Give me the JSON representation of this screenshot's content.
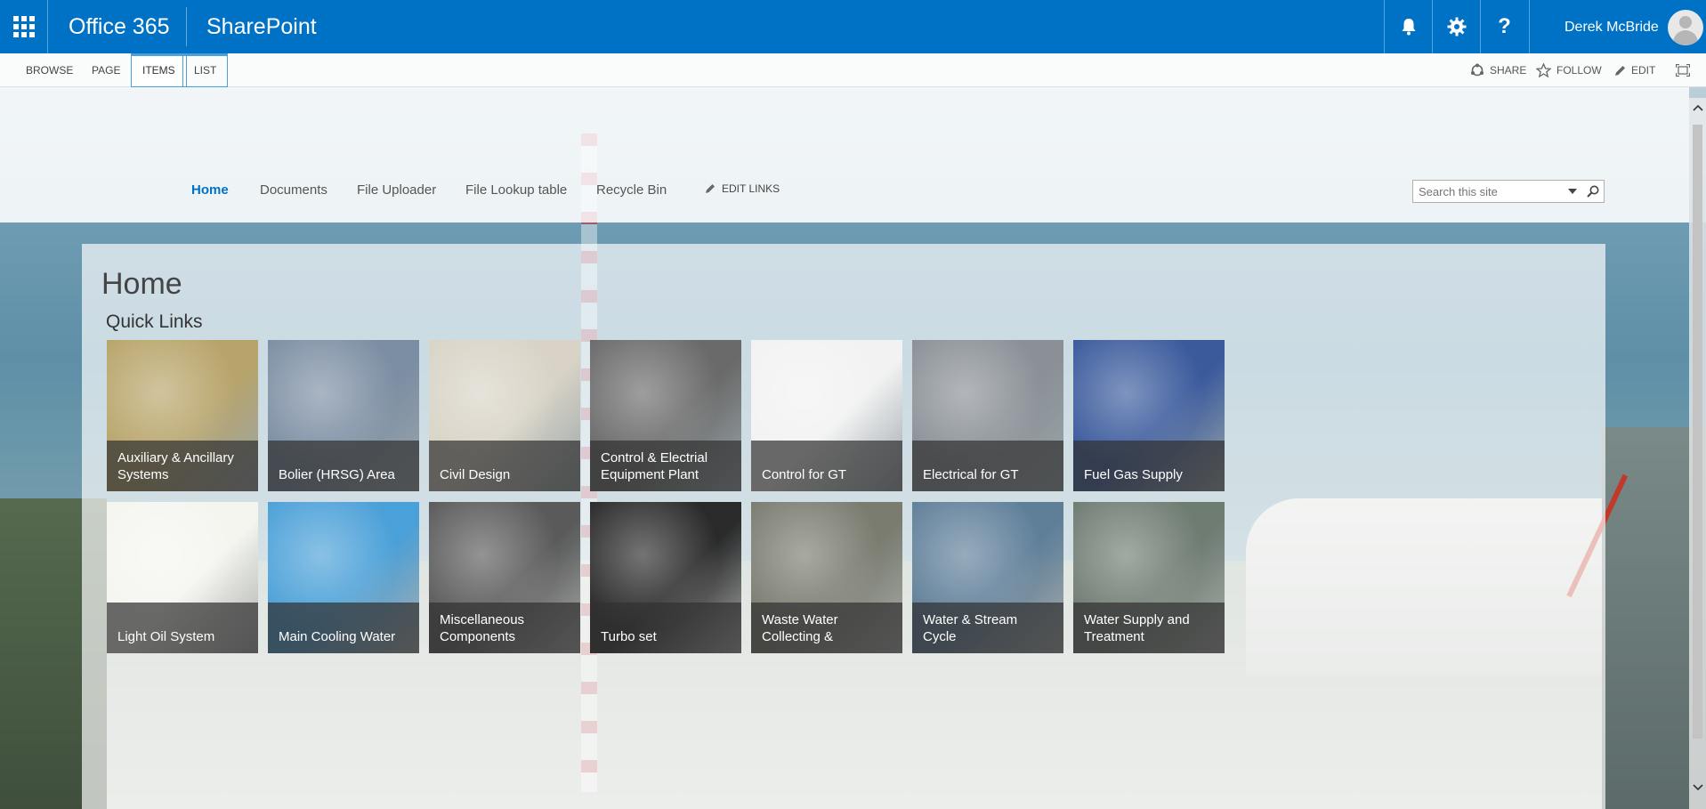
{
  "suite": {
    "brand_office": "Office 365",
    "brand_app": "SharePoint",
    "user_name": "Derek McBride",
    "icons": [
      "app-launcher-icon",
      "bell-icon",
      "gear-icon",
      "help-icon"
    ]
  },
  "ribbon": {
    "tabs": [
      "BROWSE",
      "PAGE",
      "ITEMS",
      "LIST"
    ],
    "active_tab": "ITEMS",
    "actions": {
      "share": "SHARE",
      "follow": "FOLLOW",
      "edit": "EDIT"
    }
  },
  "topnav": {
    "items": [
      "Home",
      "Documents",
      "File Uploader",
      "File Lookup table",
      "Recycle Bin"
    ],
    "selected": "Home",
    "edit_links": "EDIT LINKS"
  },
  "search": {
    "placeholder": "Search this site"
  },
  "page": {
    "title": "Home",
    "section_title": "Quick Links"
  },
  "tiles": [
    {
      "label": "Auxiliary & Ancillary Systems",
      "theme": "#b8a46a"
    },
    {
      "label": "Bolier (HRSG) Area",
      "theme": "#7c8ea3"
    },
    {
      "label": "Civil Design",
      "theme": "#d8d3c6"
    },
    {
      "label": "Control & Electrial Equipment Plant",
      "theme": "#6a6a6a"
    },
    {
      "label": "Control for GT",
      "theme": "#f2f2f2"
    },
    {
      "label": "Electrical for GT",
      "theme": "#8a9096"
    },
    {
      "label": "Fuel Gas Supply",
      "theme": "#3a5a9c"
    },
    {
      "label": "Light Oil System",
      "theme": "#f5f5f0"
    },
    {
      "label": "Main Cooling Water",
      "theme": "#4aa0d8"
    },
    {
      "label": "Miscellaneous Components",
      "theme": "#5a5a5a"
    },
    {
      "label": "Turbo set",
      "theme": "#2a2a2a"
    },
    {
      "label": "Waste Water Collecting &",
      "theme": "#7a7c70"
    },
    {
      "label": "Water & Stream Cycle",
      "theme": "#5f7f99"
    },
    {
      "label": "Water Supply and Treatment",
      "theme": "#6f7c72"
    }
  ]
}
